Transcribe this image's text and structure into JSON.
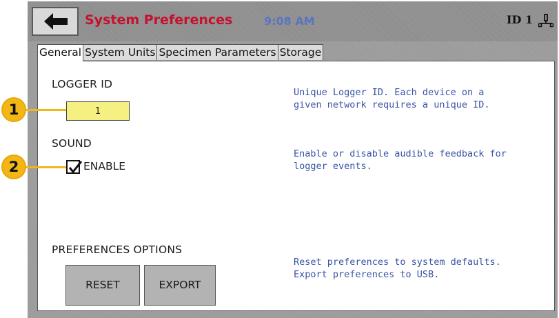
{
  "header": {
    "back_icon": "left-arrow-icon",
    "title": "System Preferences",
    "time": "9:08 AM",
    "id_label": "ID 1",
    "network_icon": "network-icon",
    "title_color": "#c8102e",
    "time_color": "#5a74c2"
  },
  "tabs": [
    {
      "label": "General",
      "active": true
    },
    {
      "label": "System Units",
      "active": false
    },
    {
      "label": "Specimen Parameters",
      "active": false
    },
    {
      "label": "Storage",
      "active": false
    }
  ],
  "general": {
    "logger_id": {
      "label": "LOGGER ID",
      "value": "1",
      "help_line1": "Unique Logger ID.  Each device on a",
      "help_line2": "given network requires a unique ID.",
      "field_color": "#f6f083"
    },
    "sound": {
      "label": "SOUND",
      "checkbox_label": "ENABLE",
      "checked": true,
      "help_line1": "Enable or disable audible feedback for",
      "help_line2": "logger events."
    },
    "options": {
      "label": "PREFERENCES OPTIONS",
      "reset_label": "RESET",
      "export_label": "EXPORT",
      "help_line1": "Reset preferences to system defaults.",
      "help_line2": "Export preferences to USB."
    }
  },
  "callouts": [
    {
      "number": "1"
    },
    {
      "number": "2"
    }
  ],
  "callout_color": "#f2b619",
  "help_color": "#3a53a4"
}
